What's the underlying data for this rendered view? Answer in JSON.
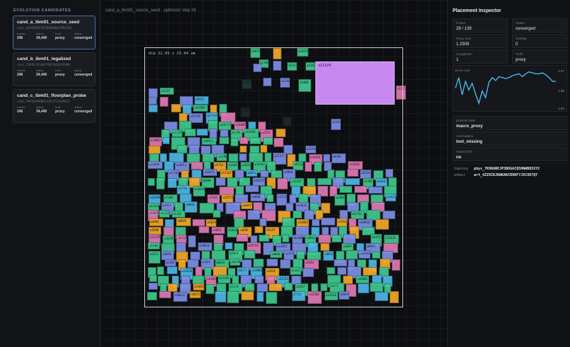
{
  "sidebar": {
    "header": "EVOLUTION CANDIDATES",
    "candidates": [
      {
        "name": "cand_a_ibm01_source_seed",
        "hash": "cand_4AXAPBXPEYATDKKKB8WATMNCX8Q",
        "frames_label": "frames",
        "frames": "246",
        "states_label": "states",
        "states": "34,440",
        "truth_label": "truth",
        "truth": "proxy",
        "status_label": "status",
        "status": "converged"
      },
      {
        "name": "cand_b_ibm01_legalized",
        "hash": "cand_21BSRC3V3AKYF9KZGXQF8Y6VBN",
        "frames_label": "frames",
        "frames": "246",
        "states_label": "states",
        "states": "34,440",
        "truth_label": "truth",
        "truth": "proxy",
        "status_label": "status",
        "status": "converged"
      },
      {
        "name": "cand_c_ibm01_floorplan_probe",
        "hash": "cand_7HP7BGH9BMBS49X2AT2SGEMXST",
        "frames_label": "frames",
        "frames": "246",
        "states_label": "states",
        "states": "34,440",
        "truth_label": "truth",
        "truth": "proxy",
        "status_label": "status",
        "status": "converged"
      }
    ]
  },
  "main": {
    "title": "cand_a_ibm01_source_seed · optimizer step 28",
    "die_label": "die 22.95 x 23.04 um",
    "macro_label": "a11324"
  },
  "inspector": {
    "title": "Placement Inspector",
    "stats": [
      {
        "k": "Frame",
        "v": "28 / 139"
      },
      {
        "k": "Status",
        "v": "converged"
      },
      {
        "k": "Proxy cost",
        "v": "1.2509"
      },
      {
        "k": "Overlap",
        "v": "0"
      },
      {
        "k": "Congestion",
        "v": "1"
      },
      {
        "k": "Truth",
        "v": "proxy"
      }
    ],
    "chart": {
      "label": "proxy cost",
      "y_max": "1.27",
      "y_mid": "1.25",
      "y_min": "1.23"
    },
    "physical_state": {
      "k": "physical state",
      "v": "macro_proxy"
    },
    "continuation": {
      "k": "continuation",
      "v": "tool_missing"
    },
    "routed_truth": {
      "k": "routed truth",
      "v": "no"
    },
    "trajectory": {
      "k": "trajectory",
      "v": "phys_7R9RANEJP3B8GACQ5HWWBQSSY2"
    },
    "artifact": {
      "k": "artifact",
      "v": "art_4ZZ8CKJKWKAKCR9KF7JXCXK7QT"
    }
  },
  "colors": {
    "green": "#3fc98f",
    "blue": "#7d8fe6",
    "pink": "#e07ab6",
    "orange": "#f2a92a",
    "cyan": "#4fb7e6",
    "macro": "#c789f0",
    "line": "#4db8e8"
  },
  "chart_data": {
    "type": "line",
    "title": "",
    "ylabel": "proxy cost",
    "ylim": [
      1.23,
      1.27
    ],
    "y_ticks": [
      "1.27",
      "1.25",
      "1.23"
    ],
    "series": [
      {
        "values": [
          1.251,
          1.262,
          1.244,
          1.258,
          1.249,
          1.256,
          1.245,
          1.235,
          1.248,
          1.241,
          1.257,
          1.262,
          1.259,
          1.263,
          1.262,
          1.261,
          1.262,
          1.264,
          1.265,
          1.266,
          1.263,
          1.266,
          1.268,
          1.267,
          1.266,
          1.266,
          1.267,
          1.265,
          1.262,
          1.258,
          1.258
        ]
      }
    ]
  },
  "cell_labels": [
    "a1477",
    "a4603",
    "a3451",
    "a3324",
    "a1266",
    "a14819",
    "a1086",
    "a18682",
    "a4735",
    "a9262",
    "a1964",
    "a4193",
    "a1143",
    "a11168",
    "a1277",
    "a4562",
    "a7228",
    "a6397",
    "a10813",
    "a7842",
    "a9441",
    "a4132",
    "a20156",
    "a15404",
    "a8021",
    "a1142",
    "a5271",
    "a2112",
    "a5965"
  ]
}
